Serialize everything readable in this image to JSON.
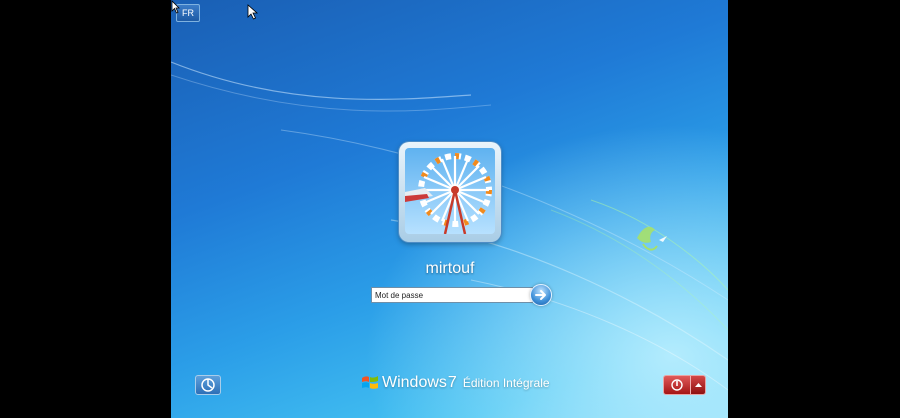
{
  "desktop": {
    "background_color": "#1f7ad6",
    "accent_bird_color": "#a6e06a"
  },
  "language": {
    "label": "FR"
  },
  "user": {
    "name": "mirtouf"
  },
  "password": {
    "placeholder": "Mot de passe",
    "value": ""
  },
  "icons": {
    "submit": "arrow-right-icon",
    "ease_of_access": "ease-of-access-icon",
    "power": "power-icon",
    "power_options": "triangle-up-icon",
    "logo": "windows-flag-icon"
  },
  "branding": {
    "product": "Windows",
    "version": "7",
    "edition": "Édition Intégrale"
  },
  "colors": {
    "power_red": "#b81d1d",
    "input_border": "#6f8fa8"
  }
}
